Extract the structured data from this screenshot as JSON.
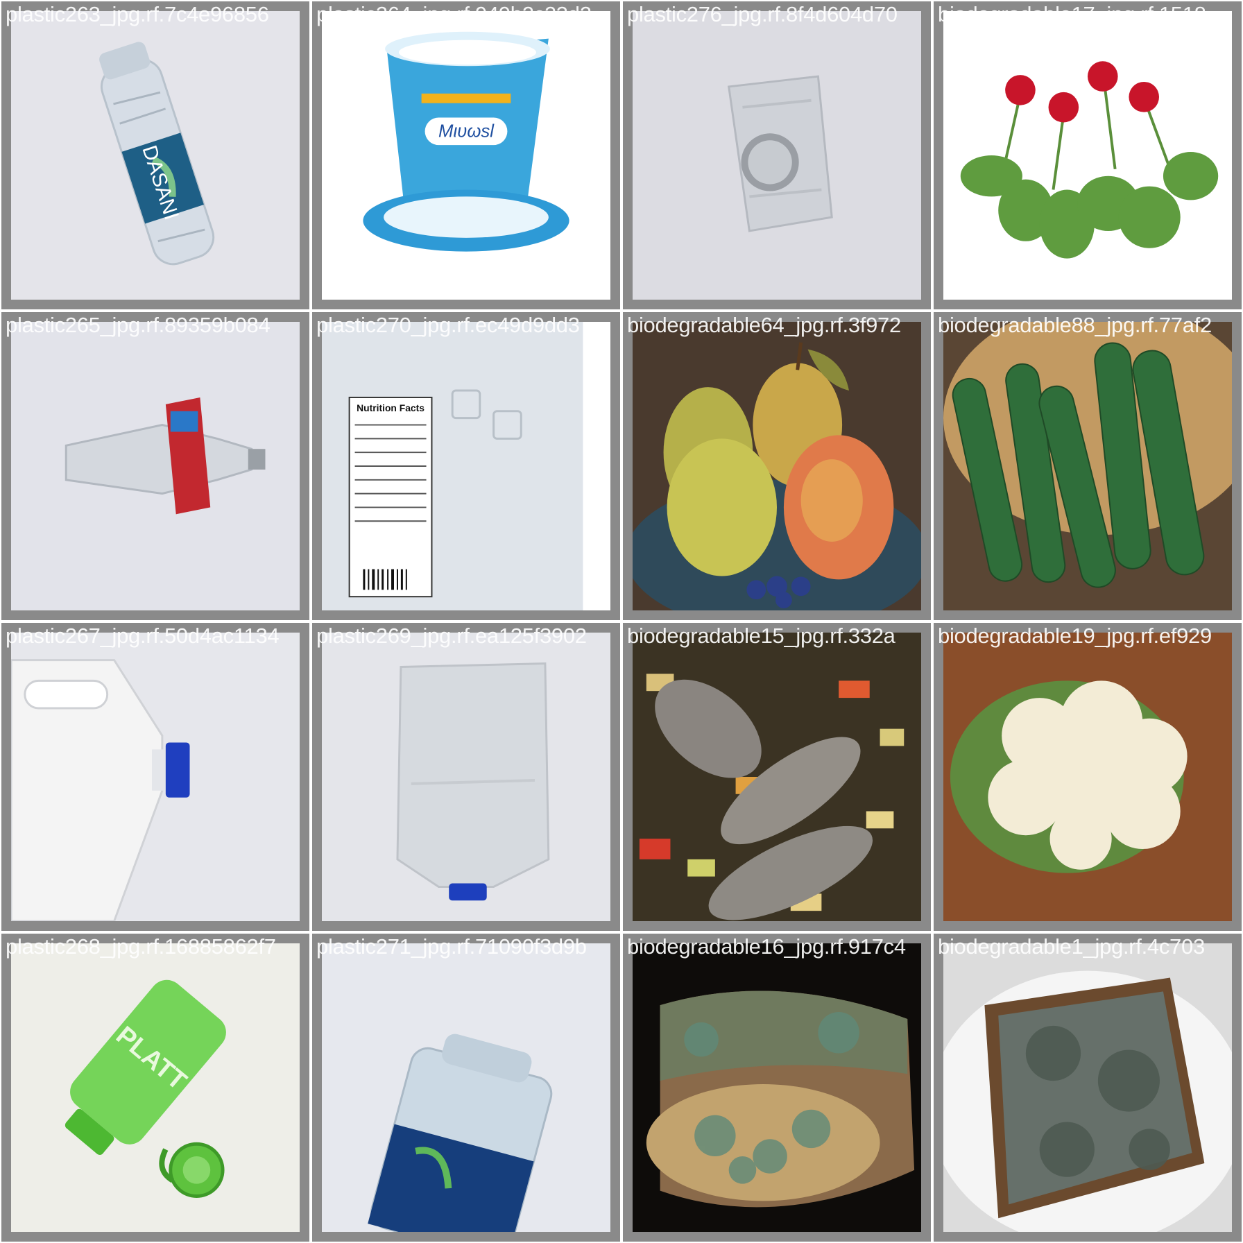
{
  "tiles": [
    {
      "caption": "plastic263_jpg.rf.7c4e96856",
      "subject": "crushed clear water bottle with blue label",
      "label_text": "DASANI"
    },
    {
      "caption": "plastic264_jpg.rf.949b2c23d2",
      "subject": "blue yogurt cup and lid",
      "label_text": "Mιυωsl"
    },
    {
      "caption": "plastic276_jpg.rf.8f4d604d70",
      "subject": "crushed clear plastic bottle top-down with cap",
      "label_text": ""
    },
    {
      "caption": "biodegradable17_jpg.rf.1518",
      "subject": "fresh radishes with leaves",
      "label_text": ""
    },
    {
      "caption": "plastic265_jpg.rf.89359b084",
      "subject": "crushed clear bottle with red label",
      "label_text": ""
    },
    {
      "caption": "plastic270_jpg.rf.ec49d9dd3",
      "subject": "clear jug with nutrition facts label",
      "label_text": "Nutrition Facts"
    },
    {
      "caption": "biodegradable64_jpg.rf.3f972",
      "subject": "bowl of pears with blueberries",
      "label_text": ""
    },
    {
      "caption": "biodegradable88_jpg.rf.77af2",
      "subject": "cucumbers in a basket",
      "label_text": ""
    },
    {
      "caption": "plastic267_jpg.rf.50d4ac1134",
      "subject": "white plastic jug with blue cap",
      "label_text": ""
    },
    {
      "caption": "plastic269_jpg.rf.ea125f3902",
      "subject": "translucent plastic container with blue cap",
      "label_text": ""
    },
    {
      "caption": "biodegradable15_jpg.rf.332a",
      "subject": "roasted fish on vegetables",
      "label_text": ""
    },
    {
      "caption": "biodegradable19_jpg.rf.ef929",
      "subject": "cauliflower on wooden board",
      "label_text": ""
    },
    {
      "caption": "plastic268_jpg.rf.16885862f7",
      "subject": "green plastic bottle with open cap",
      "label_text": "PLATT"
    },
    {
      "caption": "plastic271_jpg.rf.71090f3d9b",
      "subject": "clear water bottle with blue label",
      "label_text": ""
    },
    {
      "caption": "biodegradable16_jpg.rf.917c4",
      "subject": "moldy loaf of bread",
      "label_text": ""
    },
    {
      "caption": "biodegradable1_jpg.rf.4c703",
      "subject": "moldy slice of bread on plate",
      "label_text": ""
    }
  ]
}
